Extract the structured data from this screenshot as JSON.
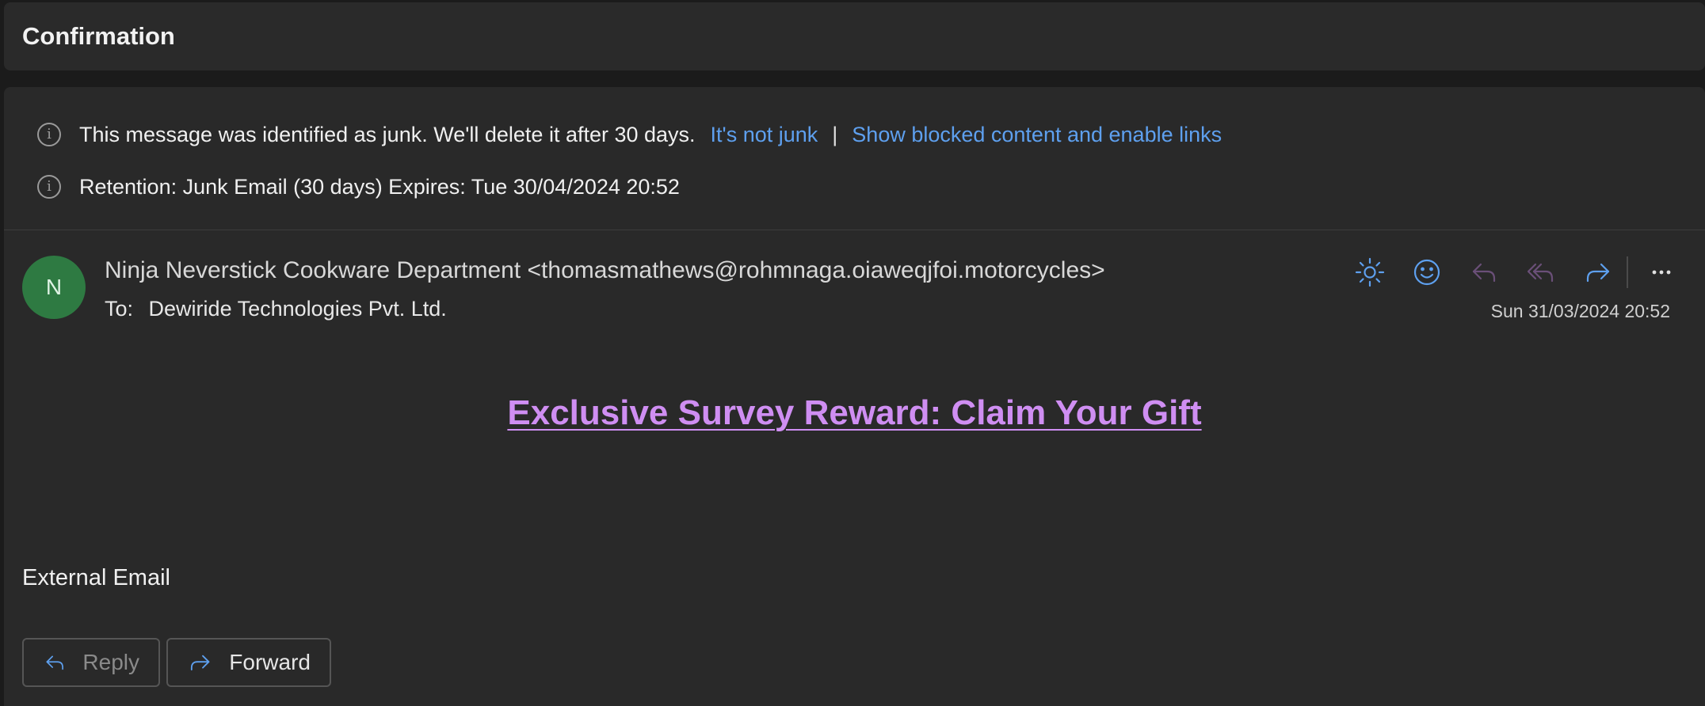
{
  "subject": "Confirmation",
  "banner": {
    "junk_text": "This message was identified as junk. We'll delete it after 30 days.",
    "not_junk_link": "It's not junk",
    "separator": "|",
    "show_blocked_link": "Show blocked content and enable links",
    "retention_text": "Retention: Junk Email (30 days) Expires: Tue 30/04/2024 20:52",
    "info_icon": "info-icon"
  },
  "message": {
    "avatar_initial": "N",
    "sender": "Ninja Neverstick Cookware Department <thomasmathews@rohmnaga.oiaweqjfoi.motorcycles>",
    "to_label": "To:",
    "to_value": "Dewiride Technologies Pvt. Ltd.",
    "date": "Sun 31/03/2024 20:52",
    "headline": "Exclusive Survey Reward: Claim Your Gift",
    "external_label": "External Email"
  },
  "actions": {
    "icons": [
      "brightness-icon",
      "emoji-icon",
      "reply-icon",
      "reply-all-icon",
      "forward-icon",
      "more-icon"
    ],
    "more_label": "···"
  },
  "buttons": {
    "reply_label": "Reply",
    "forward_label": "Forward"
  },
  "colors": {
    "accent": "#5ea0ef",
    "disabled_icon": "#6a4f78",
    "headline": "#cf8ef2",
    "avatar": "#2e7a42"
  }
}
